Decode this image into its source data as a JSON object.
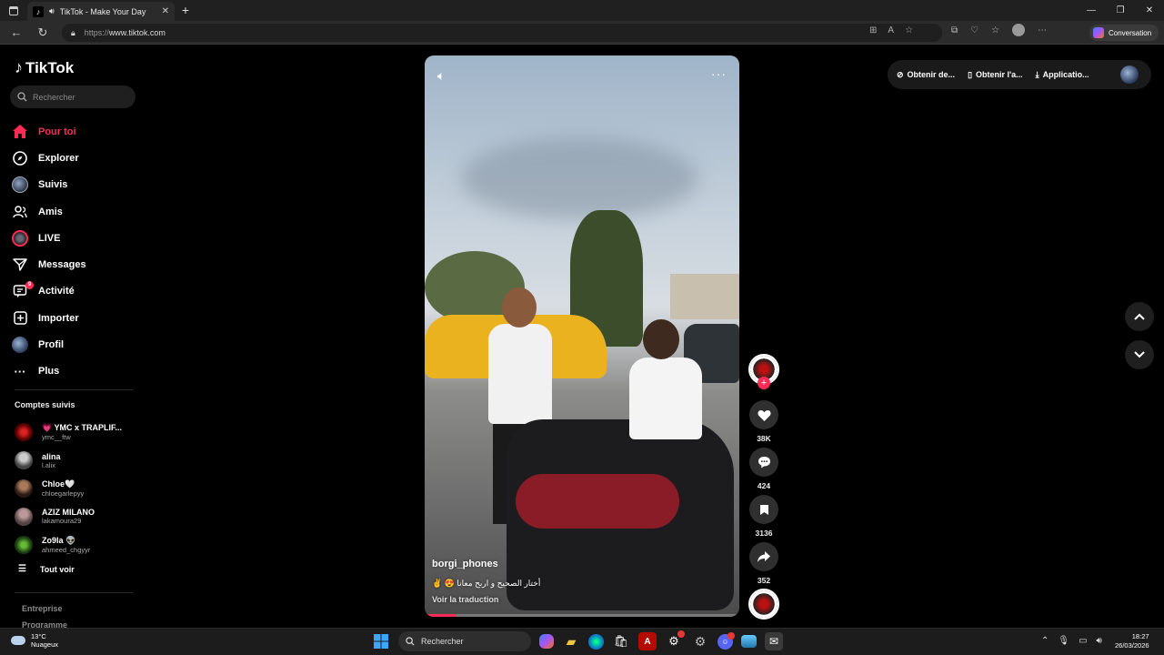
{
  "browser": {
    "tab_title": "TikTok - Make Your Day",
    "url_proto": "https://",
    "url_host": "www.tiktok.com",
    "conversation_label": "Conversation"
  },
  "sidebar": {
    "logo_text": "TikTok",
    "search_placeholder": "Rechercher",
    "menu": [
      {
        "label": "Pour toi",
        "icon": "home-icon"
      },
      {
        "label": "Explorer",
        "icon": "compass-icon"
      },
      {
        "label": "Suivis",
        "icon": "following-avatar-icon"
      },
      {
        "label": "Amis",
        "icon": "friends-icon"
      },
      {
        "label": "LIVE",
        "icon": "live-icon"
      },
      {
        "label": "Messages",
        "icon": "send-icon"
      },
      {
        "label": "Activité",
        "icon": "activity-icon",
        "badge": "9"
      },
      {
        "label": "Importer",
        "icon": "upload-icon"
      },
      {
        "label": "Profil",
        "icon": "profile-avatar-icon"
      },
      {
        "label": "Plus",
        "icon": "more-icon"
      }
    ],
    "followed_title": "Comptes suivis",
    "followed": [
      {
        "name": "💗 YMC x TRAPLIF...",
        "handle": "ymc__ftw",
        "color": "#8b0d0d"
      },
      {
        "name": "alina",
        "handle": "l.alix",
        "color": "#5a5a5a"
      },
      {
        "name": "Chloe🤍",
        "handle": "chloegarlepyy",
        "color": "#3a2a24"
      },
      {
        "name": "AZIZ MILANO",
        "handle": "lakamoura29",
        "color": "#6a5a5a"
      },
      {
        "name": "Zo9la 👽",
        "handle": "ahmeed_chgyyr",
        "color": "#2d5a1e"
      }
    ],
    "see_all": "Tout voir",
    "company": "Entreprise",
    "programs": "Programme"
  },
  "video": {
    "author": "borgi_phones",
    "description": "✌️ 😍 أختار الصحيح و اربح معانا",
    "translate": "Voir la traduction",
    "progress": 0.1
  },
  "actions": {
    "likes": "38K",
    "comments": "424",
    "saves": "3136",
    "shares": "352"
  },
  "topright": {
    "item1": "Obtenir de...",
    "item2": "Obtenir l'a...",
    "item3": "Applicatio..."
  },
  "taskbar": {
    "temp": "13°C",
    "weather": "Nuageux",
    "search": "Rechercher",
    "time": "18:27",
    "date": "26/03/2026"
  }
}
